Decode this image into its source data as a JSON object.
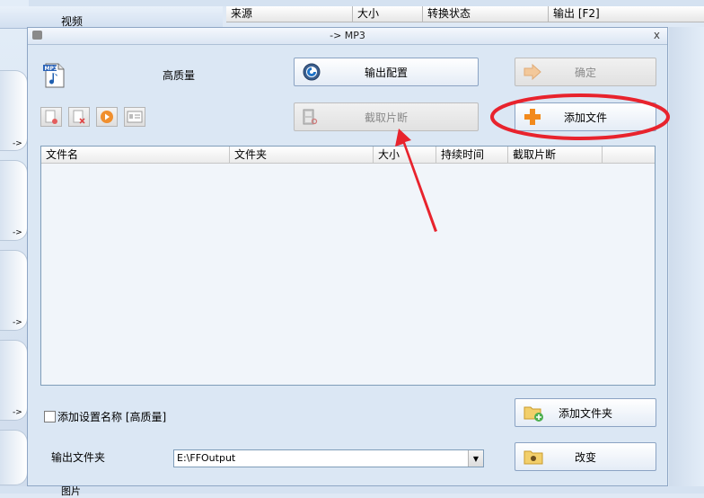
{
  "background": {
    "video_label": "视频",
    "picture_label": "图片",
    "arrow_marks": [
      "->",
      "->",
      "->",
      "->"
    ],
    "columns": [
      "来源",
      "大小",
      "转换状态",
      "输出 [F2]"
    ]
  },
  "dialog": {
    "title": "-> MP3",
    "close": "x",
    "quality": "高质量",
    "buttons": {
      "output_config": "输出配置",
      "ok": "确定",
      "clip": "截取片断",
      "add_file": "添加文件",
      "add_folder": "添加文件夹",
      "change": "改变"
    },
    "file_list": {
      "headers": [
        "文件名",
        "文件夹",
        "大小",
        "持续时间",
        "截取片断"
      ],
      "rows": []
    },
    "save_name_checkbox": "添加设置名称 [高质量]",
    "output_folder_label": "输出文件夹",
    "output_folder_value": "E:\\FFOutput"
  },
  "colors": {
    "annotation_red": "#e8232d",
    "accent_orange": "#f28a1c"
  }
}
